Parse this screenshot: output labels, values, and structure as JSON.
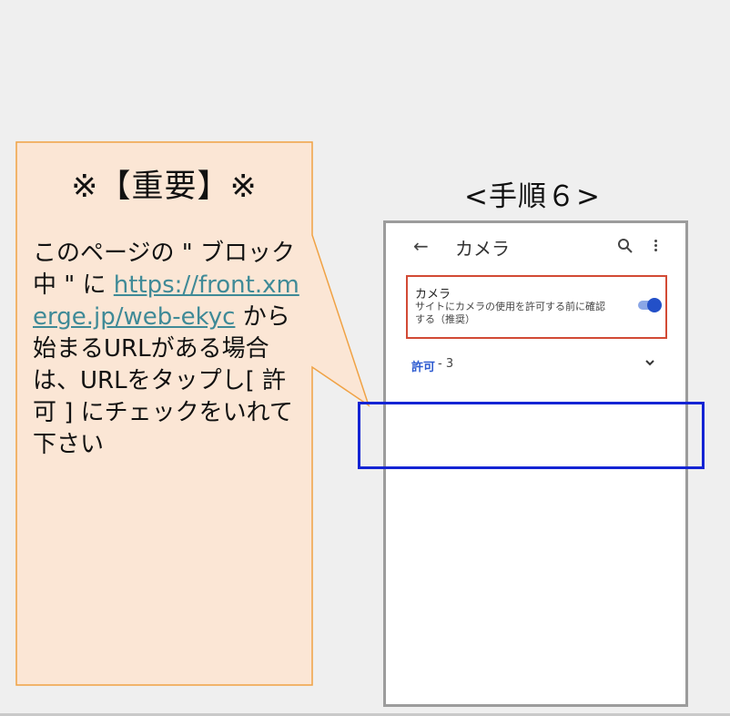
{
  "note": {
    "title": "※【重要】※",
    "text_1": "このページの \" ブロック中 \" に ",
    "link_url": "https://front.xmerge.jp/web-ekyc",
    "text_2": " から始まるURLがある場合は、URLをタップし[ 許可 ] にチェックをいれて下さい"
  },
  "step": {
    "label": "<手順６>"
  },
  "phone": {
    "header": {
      "back_icon": "arrow-left-icon",
      "title": "カメラ",
      "search_icon": "search-icon",
      "menu_icon": "more-vert-icon"
    },
    "setting": {
      "title": "カメラ",
      "description": "サイトにカメラの使用を許可する前に確認する（推奨）",
      "toggle_on": true
    },
    "allow": {
      "label": "許可",
      "count": " - 3",
      "expand_icon": "chevron-down-icon"
    }
  },
  "colors": {
    "bubble_fill": "#fbe6d5",
    "bubble_border": "#f0a244",
    "link": "#3f8a97",
    "setting_border": "#d24a35",
    "highlight": "#1424d4",
    "toggle": "#2350c8"
  }
}
